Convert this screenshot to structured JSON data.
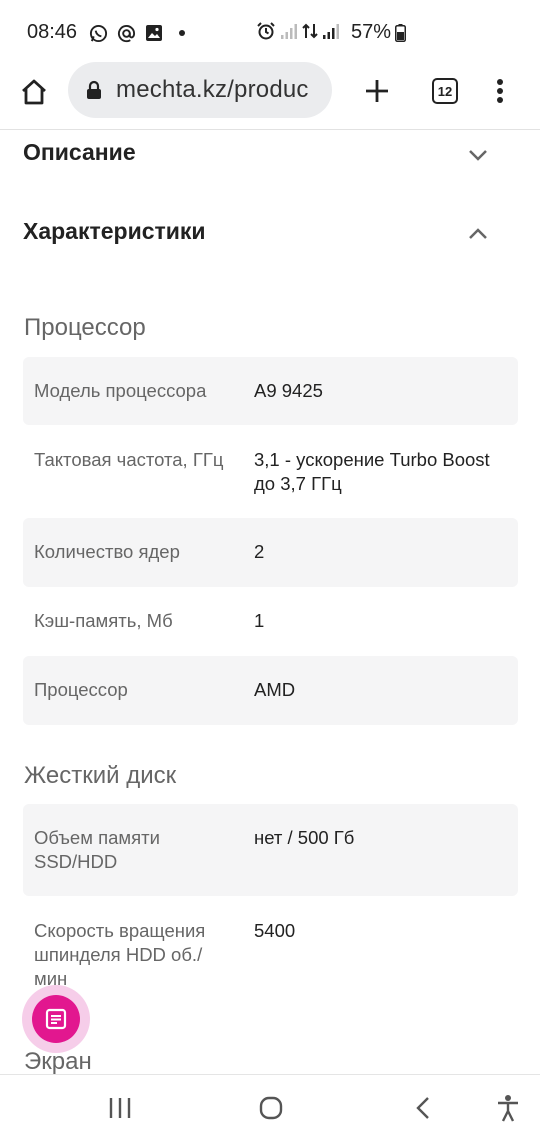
{
  "status_bar": {
    "time": "08:46",
    "left_icons": [
      "whatsapp-icon",
      "at-sign-icon",
      "gallery-icon",
      "dot-icon"
    ],
    "right_icons": [
      "alarm-icon",
      "signal-weak-icon",
      "data-transfer-icon",
      "signal-icon"
    ],
    "battery_percent": "57%",
    "battery_level": 0.57
  },
  "browser": {
    "url": "mechta.kz/produc",
    "tab_count": "12"
  },
  "accordions": {
    "description": {
      "label": "Описание",
      "state": "collapsed"
    },
    "specs": {
      "label": "Характеристики",
      "state": "expanded"
    }
  },
  "sections": {
    "processor": {
      "title": "Процессор",
      "rows": [
        {
          "label": "Модель процессора",
          "value": "A9 9425"
        },
        {
          "label": "Тактовая частота, ГГц",
          "value": "3,1 - ускорение Turbo Boost до 3,7 ГГц"
        },
        {
          "label": "Количество ядер",
          "value": "2"
        },
        {
          "label": "Кэш-память, Мб",
          "value": "1"
        },
        {
          "label": "Процессор",
          "value": "AMD"
        }
      ]
    },
    "hdd": {
      "title": "Жесткий диск",
      "rows": [
        {
          "label": "Объем памяти SSD/HDD",
          "value": "нет / 500 Гб"
        },
        {
          "label": "Скорость вращения шпинделя HDD об./мин",
          "value": "5400"
        }
      ]
    },
    "screen": {
      "title": "Экран"
    }
  },
  "colors": {
    "accent": "#e2178f",
    "accent_halo": "#f6cde9",
    "row_shade": "#f5f5f6",
    "url_bar": "#ebecee"
  }
}
